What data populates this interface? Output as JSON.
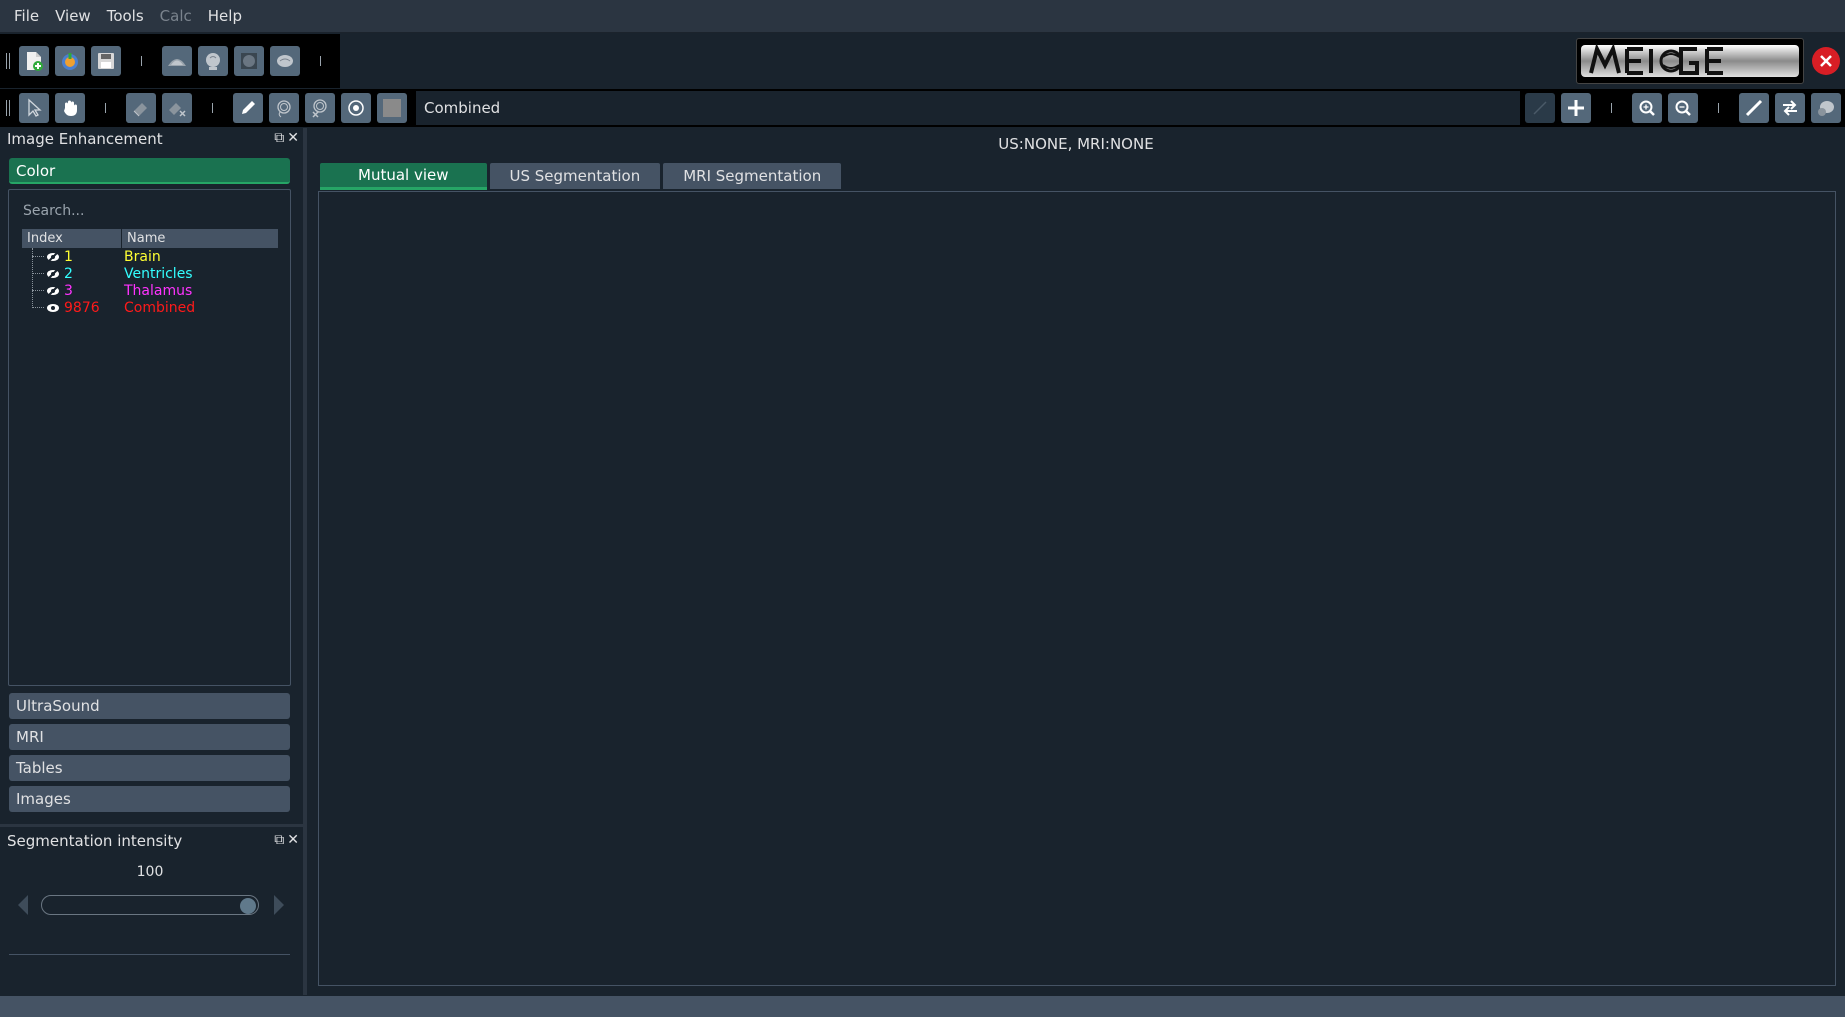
{
  "menu": {
    "items": [
      {
        "label": "File",
        "enabled": true
      },
      {
        "label": "View",
        "enabled": true
      },
      {
        "label": "Tools",
        "enabled": true
      },
      {
        "label": "Calc",
        "enabled": false
      },
      {
        "label": "Help",
        "enabled": true
      }
    ]
  },
  "toolbar2": {
    "label_combo": "Combined"
  },
  "dock_image_enhancement": {
    "title": "Image Enhancement",
    "color_section": "Color",
    "search_placeholder": "Search...",
    "columns": [
      "Index",
      "Name"
    ],
    "labels": [
      {
        "index": "1",
        "name": "Brain",
        "color": "#ffff33",
        "icon": "eye-hidden-icon"
      },
      {
        "index": "2",
        "name": "Ventricles",
        "color": "#33ffff",
        "icon": "eye-hidden-icon"
      },
      {
        "index": "3",
        "name": "Thalamus",
        "color": "#ff33ff",
        "icon": "eye-hidden-icon"
      },
      {
        "index": "9876",
        "name": "Combined",
        "color": "#ff1a1a",
        "icon": "eye-visible-icon"
      }
    ],
    "sections": [
      "UltraSound",
      "MRI",
      "Tables",
      "Images"
    ]
  },
  "dock_segmentation": {
    "title": "Segmentation intensity",
    "value": "100",
    "slider_fraction": 1.0
  },
  "central": {
    "info": "US:NONE, MRI:NONE",
    "tabs": [
      "Mutual view",
      "US Segmentation",
      "MRI Segmentation"
    ],
    "active_tab": 0
  },
  "colors": {
    "accent": "#1a7250",
    "close": "#d81e25"
  }
}
